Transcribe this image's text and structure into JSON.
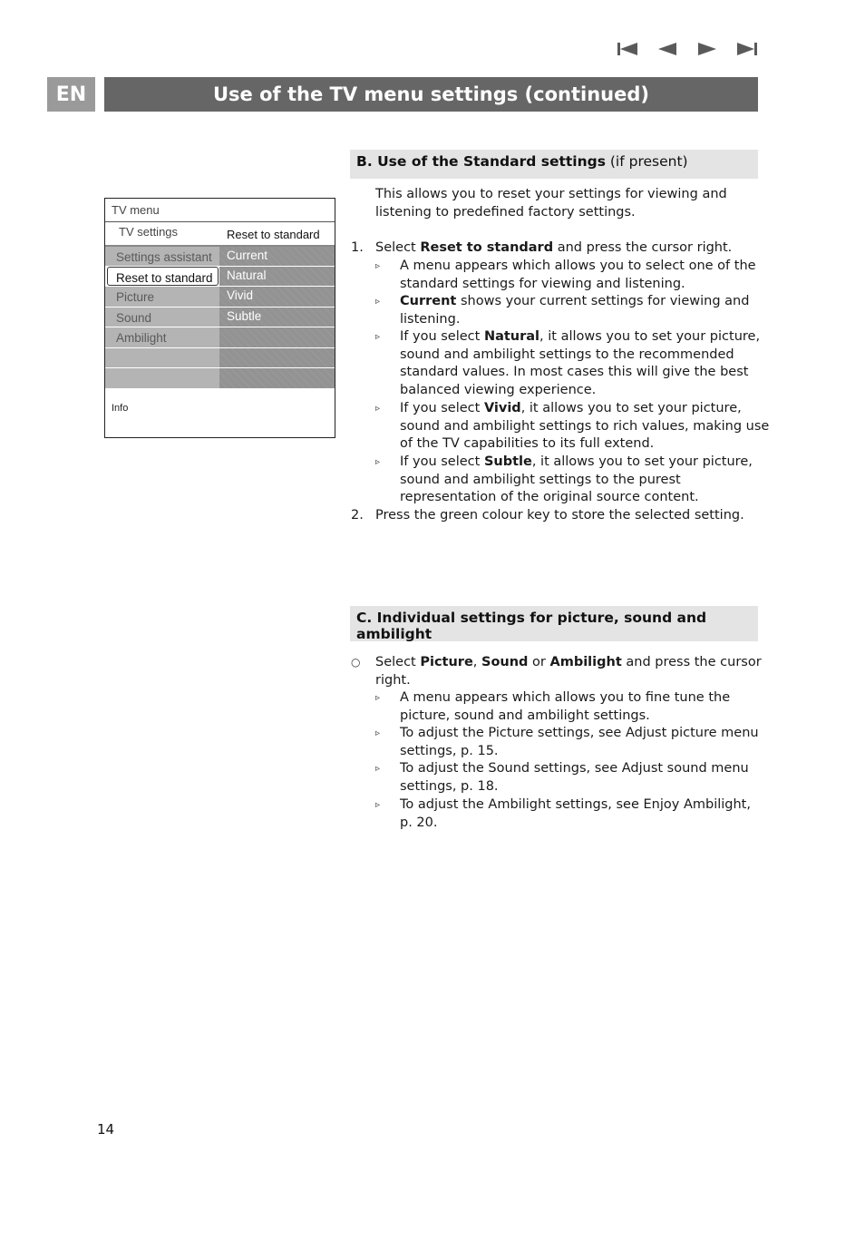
{
  "nav": {
    "icons": [
      "first-page-icon",
      "previous-page-icon",
      "next-page-icon",
      "last-page-icon"
    ]
  },
  "header": {
    "language_tab": "EN",
    "title": "Use of the TV menu settings  (continued)"
  },
  "tv_menu": {
    "title": "TV menu",
    "submenu_left": "TV settings",
    "submenu_right": "Reset to standard",
    "left_items": [
      "Settings assistant",
      "Reset to standard",
      "Picture",
      "Sound",
      "Ambilight",
      "",
      ""
    ],
    "selected_index": 1,
    "right_items": [
      "Current",
      "Natural",
      "Vivid",
      "Subtle",
      "",
      "",
      ""
    ],
    "info_label": "Info"
  },
  "section_b": {
    "heading_bold": "B. Use of the Standard settings",
    "heading_normal": " (if present)",
    "intro": [
      "This allows you to reset your settings for viewing and",
      "listening to predefined factory settings."
    ],
    "step1": {
      "num": "1.",
      "pre": "Select ",
      "bold": "Reset to standard",
      "post": " and press the cursor right."
    },
    "bullets": [
      {
        "lines": [
          "A menu appears which allows you to select one of the",
          "standard settings for viewing and listening."
        ]
      },
      {
        "bold": "Current",
        "lines": [
          " shows your current settings for viewing and",
          "listening."
        ]
      },
      {
        "pre": "If you select ",
        "bold": "Natural",
        "lines": [
          ", it allows you to set your picture,",
          "sound and ambilight settings to the recommended",
          "standard values. In most cases this will give the best",
          "balanced viewing experience."
        ]
      },
      {
        "pre": "If you select ",
        "bold": "Vivid",
        "lines": [
          ", it allows you to set your picture,",
          "sound and ambilight settings to rich values, making use",
          "of the TV capabilities to its full extend."
        ]
      },
      {
        "pre": "If you select ",
        "bold": "Subtle",
        "lines": [
          ", it allows you to set your picture,",
          "sound and ambilight settings to the purest",
          "representation of the original source content."
        ]
      }
    ],
    "step2": {
      "num": "2.",
      "text": "Press the green colour key to store the selected setting."
    }
  },
  "section_c": {
    "heading": "C. Individual settings for picture, sound and ambilight",
    "main": {
      "pre": "Select ",
      "b1": "Picture",
      "sep1": ", ",
      "b2": "Sound",
      "sep2": " or ",
      "b3": "Ambilight",
      "post": " and press the cursor",
      "line2": "right."
    },
    "bullets": [
      [
        "A menu appears which allows you to fine tune the",
        "picture, sound and ambilight settings."
      ],
      [
        "To adjust the Picture settings, see Adjust picture menu",
        "settings, p. 15."
      ],
      [
        "To adjust the Sound settings, see Adjust sound menu",
        "settings, p. 18."
      ],
      [
        "To adjust the Ambilight settings, see Enjoy Ambilight,",
        "p. 20."
      ]
    ]
  },
  "footer": {
    "page_number": "14"
  },
  "symbols": {
    "triangle": "▹",
    "circle": "○"
  }
}
